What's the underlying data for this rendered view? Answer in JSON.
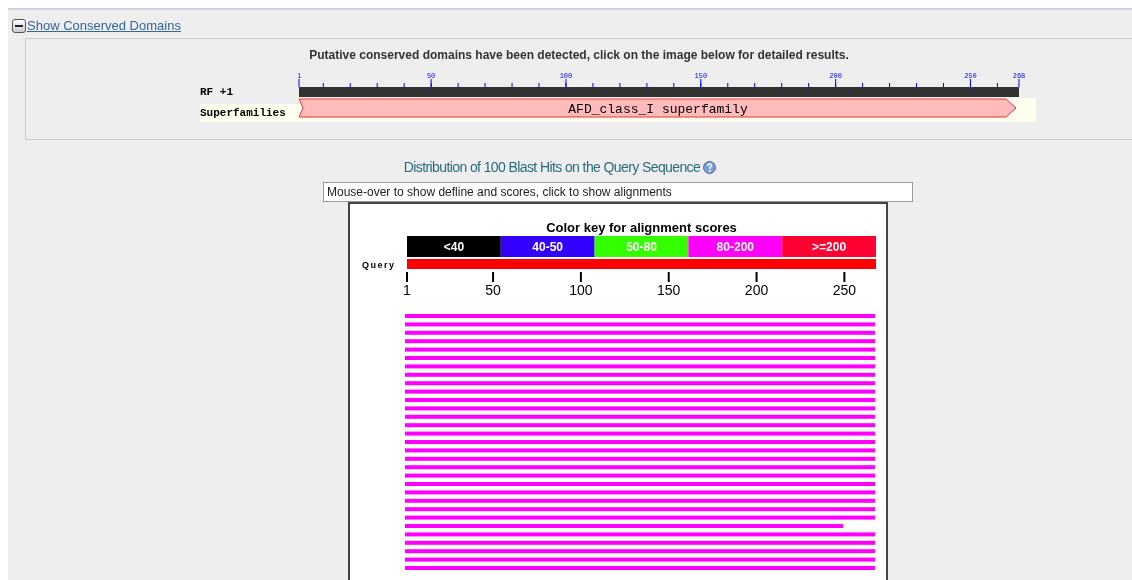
{
  "section_toggle": {
    "label": "Show Conserved Domains",
    "expanded": true
  },
  "conserved_domains": {
    "message": "Putative conserved domains have been detected, click on the image below for detailed results.",
    "ruler_ticks": [
      "1",
      "50",
      "100",
      "150",
      "200",
      "250",
      "268"
    ],
    "tracks": [
      {
        "kind": "ruler",
        "label": "RF +1"
      },
      {
        "kind": "domain",
        "label": "Superfamilies",
        "domain": "AFD_class_I superfamily"
      }
    ]
  },
  "distribution": {
    "title": "Distribution of 100 Blast Hits on the Query Sequence",
    "info_field": {
      "value": "Mouse-over to show defline and scores, click to show alignments"
    },
    "color_key_title": "Color key for alignment scores",
    "color_key": [
      {
        "label": "<40",
        "color": "#000000"
      },
      {
        "label": "40-50",
        "color": "#3300ff"
      },
      {
        "label": "50-80",
        "color": "#33ff00"
      },
      {
        "label": "80-200",
        "color": "#ff00ff"
      },
      {
        "label": ">=200",
        "color": "#ff0033"
      }
    ],
    "query_label": "Query",
    "axis_ticks": [
      "1",
      "50",
      "100",
      "150",
      "200",
      "250"
    ],
    "hits": [
      {
        "kind": "full",
        "color": "#ff00ff"
      },
      {
        "kind": "full",
        "color": "#ff00ff"
      },
      {
        "kind": "full",
        "color": "#ff00ff"
      },
      {
        "kind": "full",
        "color": "#ff00ff"
      },
      {
        "kind": "full",
        "color": "#ff00ff"
      },
      {
        "kind": "full",
        "color": "#ff00ff"
      },
      {
        "kind": "full",
        "color": "#ff00ff"
      },
      {
        "kind": "full",
        "color": "#ff00ff"
      },
      {
        "kind": "full",
        "color": "#ff00ff"
      },
      {
        "kind": "full",
        "color": "#ff00ff"
      },
      {
        "kind": "full",
        "color": "#ff00ff"
      },
      {
        "kind": "full",
        "color": "#ff00ff"
      },
      {
        "kind": "full",
        "color": "#ff00ff"
      },
      {
        "kind": "full",
        "color": "#ff00ff"
      },
      {
        "kind": "full",
        "color": "#ff00ff"
      },
      {
        "kind": "full",
        "color": "#ff00ff"
      },
      {
        "kind": "full",
        "color": "#ff00ff"
      },
      {
        "kind": "full",
        "color": "#ff00ff"
      },
      {
        "kind": "full",
        "color": "#ff00ff"
      },
      {
        "kind": "full",
        "color": "#ff00ff"
      },
      {
        "kind": "full",
        "color": "#ff00ff"
      },
      {
        "kind": "full",
        "color": "#ff00ff"
      },
      {
        "kind": "full",
        "color": "#ff00ff"
      },
      {
        "kind": "full",
        "color": "#ff00ff"
      },
      {
        "kind": "full",
        "color": "#ff00ff"
      },
      {
        "kind": "partial",
        "color": "#ff00ff"
      },
      {
        "kind": "full",
        "color": "#ff00ff"
      },
      {
        "kind": "full",
        "color": "#ff00ff"
      },
      {
        "kind": "full",
        "color": "#ff00ff"
      },
      {
        "kind": "full",
        "color": "#ff00ff"
      },
      {
        "kind": "full",
        "color": "#ff00ff"
      }
    ]
  }
}
